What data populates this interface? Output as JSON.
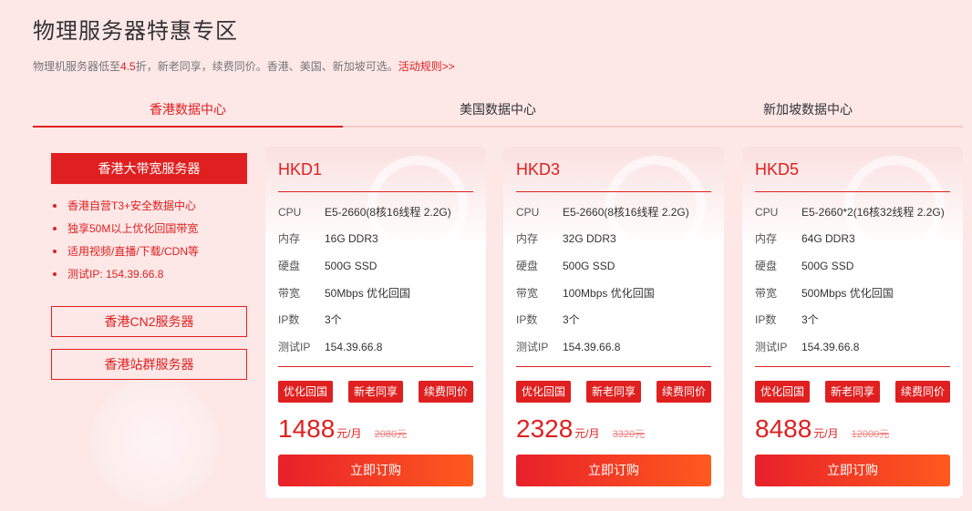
{
  "header": {
    "title": "物理服务器特惠专区",
    "subtitle_pre": "物理机服务器低至",
    "discount": "4.5",
    "subtitle_mid": "折，新老同享，续费同价。香港、美国、新加坡可选。",
    "rules_link": "活动规则>>"
  },
  "tabs": [
    {
      "label": "香港数据中心",
      "active": true
    },
    {
      "label": "美国数据中心",
      "active": false
    },
    {
      "label": "新加坡数据中心",
      "active": false
    }
  ],
  "sidebar": {
    "active_button": "香港大带宽服务器",
    "features": [
      "香港自营T3+安全数据中心",
      "独享50M以上优化回国带宽",
      "适用视频/直播/下载/CDN等",
      "测试IP: 154.39.66.8"
    ],
    "other_buttons": [
      "香港CN2服务器",
      "香港站群服务器"
    ]
  },
  "spec_labels": {
    "cpu": "CPU",
    "memory": "内存",
    "disk": "硬盘",
    "bandwidth": "带宽",
    "ip_count": "IP数",
    "test_ip": "测试IP"
  },
  "tags": [
    "优化回国",
    "新老同享",
    "续费同价"
  ],
  "price_unit": "元/月",
  "order_label": "立即订购",
  "products": [
    {
      "name": "HKD1",
      "cpu": "E5-2660(8核16线程 2.2G)",
      "memory": "16G DDR3",
      "disk": "500G SSD",
      "bandwidth": "50Mbps 优化回国",
      "ip_count": "3个",
      "test_ip": "154.39.66.8",
      "price": "1488",
      "old_price": "2080元"
    },
    {
      "name": "HKD3",
      "cpu": "E5-2660(8核16线程 2.2G)",
      "memory": "32G DDR3",
      "disk": "500G SSD",
      "bandwidth": "100Mbps 优化回国",
      "ip_count": "3个",
      "test_ip": "154.39.66.8",
      "price": "2328",
      "old_price": "3320元"
    },
    {
      "name": "HKD5",
      "cpu": "E5-2660*2(16核32线程 2.2G)",
      "memory": "64G DDR3",
      "disk": "500G SSD",
      "bandwidth": "500Mbps 优化回国",
      "ip_count": "3个",
      "test_ip": "154.39.66.8",
      "price": "8488",
      "old_price": "12000元"
    }
  ],
  "colors": {
    "accent": "#e02020",
    "background": "#fde7e7",
    "order_gradient_end": "#ff5a1e"
  }
}
